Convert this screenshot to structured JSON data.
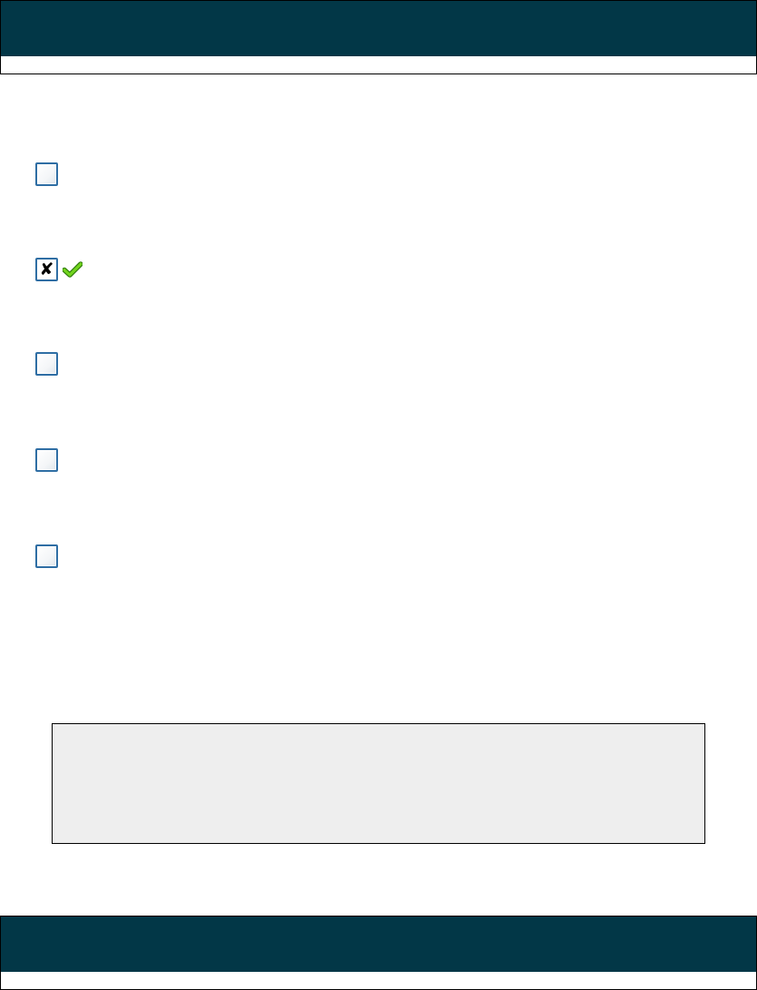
{
  "header": {
    "bar_color": "#023747",
    "icon": "none"
  },
  "options": [
    {
      "checked": false,
      "feedback_icon": ""
    },
    {
      "checked": true,
      "feedback_icon": "green-checkmark-icon"
    },
    {
      "checked": false,
      "feedback_icon": ""
    },
    {
      "checked": false,
      "feedback_icon": ""
    },
    {
      "checked": false,
      "feedback_icon": ""
    }
  ],
  "checked_mark": "✘",
  "feedback_panel": {
    "text": "",
    "background": "#eeeeee"
  },
  "footer": {
    "bar_color": "#023747"
  },
  "colors": {
    "checkbox_border": "#2f6ea4",
    "check_green": "#5cc21a"
  }
}
